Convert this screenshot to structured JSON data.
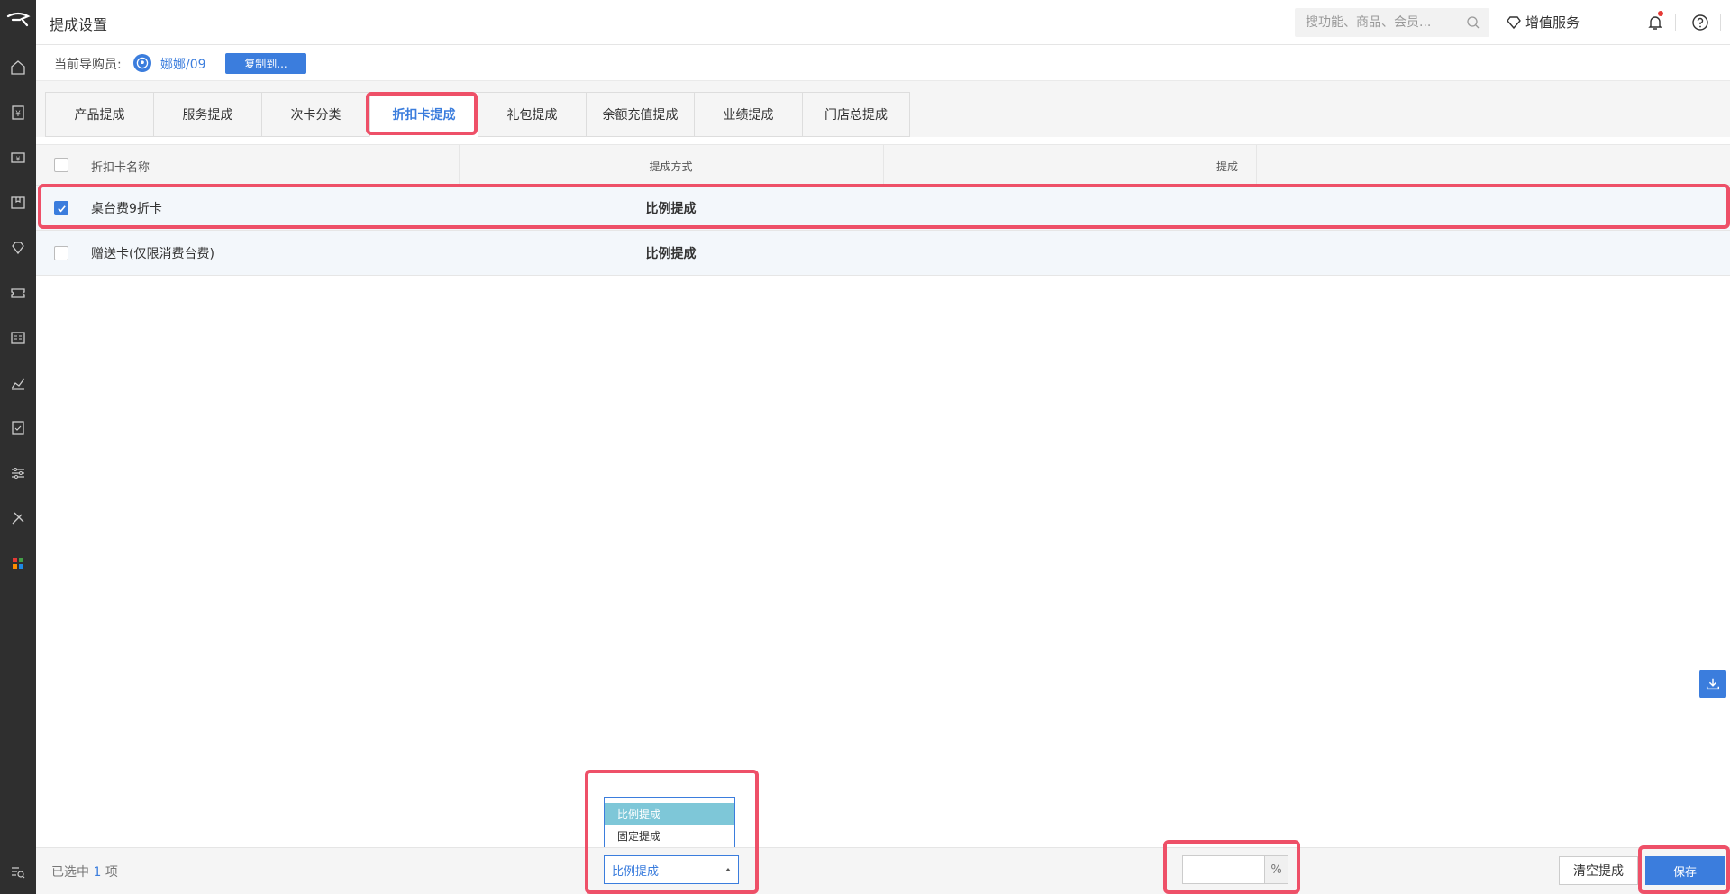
{
  "header": {
    "title": "提成设置",
    "search_placeholder": "搜功能、商品、会员...",
    "value_added_label": "增值服务"
  },
  "subbar": {
    "guide_label": "当前导购员:",
    "guide_name": "娜娜/09",
    "copy_button": "复制到..."
  },
  "tabs": [
    {
      "label": "产品提成",
      "active": false
    },
    {
      "label": "服务提成",
      "active": false
    },
    {
      "label": "次卡分类",
      "active": false
    },
    {
      "label": "折扣卡提成",
      "active": true
    },
    {
      "label": "礼包提成",
      "active": false
    },
    {
      "label": "余额充值提成",
      "active": false
    },
    {
      "label": "业绩提成",
      "active": false
    },
    {
      "label": "门店总提成",
      "active": false
    }
  ],
  "table": {
    "columns": [
      "折扣卡名称",
      "提成方式",
      "提成"
    ],
    "rows": [
      {
        "name": "桌台费9折卡",
        "method": "比例提成",
        "commission": "",
        "checked": true
      },
      {
        "name": "赠送卡(仅限消费台费)",
        "method": "比例提成",
        "commission": "",
        "checked": false
      }
    ]
  },
  "bottom": {
    "selected_prefix": "已选中",
    "selected_count": "1",
    "selected_suffix": "项",
    "method_value": "比例提成",
    "method_options": [
      "比例提成",
      "固定提成"
    ],
    "percent_value": "",
    "percent_unit": "%",
    "clear_button": "清空提成",
    "save_button": "保存"
  },
  "colors": {
    "accent": "#3b7ddd",
    "sidebar_bg": "#2f2f2f",
    "highlight": "#ee5068"
  }
}
